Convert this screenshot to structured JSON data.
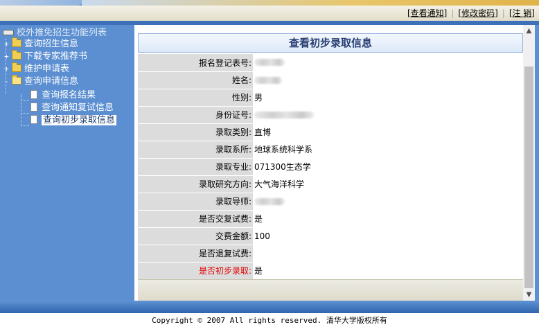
{
  "topnav": {
    "links": [
      "[查看通知]",
      "[修改密码]",
      "[注 销]"
    ],
    "separator": "|"
  },
  "sidebar": {
    "root_label": "校外推免招生功能列表",
    "items": [
      {
        "label": "查询招生信息",
        "icon": "folder-icon",
        "toggle": "+"
      },
      {
        "label": "下载专家推荐书",
        "icon": "folder-icon",
        "toggle": "+"
      },
      {
        "label": "维护申请表",
        "icon": "folder-icon",
        "toggle": "+"
      },
      {
        "label": "查询申请信息",
        "icon": "folder-open-icon",
        "toggle": "-",
        "children": [
          {
            "label": "查询报名结果",
            "icon": "document-icon"
          },
          {
            "label": "查询通知复试信息",
            "icon": "document-icon"
          },
          {
            "label": "查询初步录取信息",
            "icon": "document-icon",
            "selected": true
          }
        ]
      }
    ]
  },
  "main": {
    "title": "查看初步录取信息",
    "rows": [
      {
        "label": "报名登记表号:",
        "value": "",
        "redacted": true
      },
      {
        "label": "姓名:",
        "value": "",
        "redacted": true
      },
      {
        "label": "性别:",
        "value": "男"
      },
      {
        "label": "身份证号:",
        "value": "",
        "redacted": true
      },
      {
        "label": "录取类别:",
        "value": "直博"
      },
      {
        "label": "录取系所:",
        "value": "地球系统科学系"
      },
      {
        "label": "录取专业:",
        "value": "071300生态学"
      },
      {
        "label": "录取研究方向:",
        "value": "大气海洋科学"
      },
      {
        "label": "录取导师:",
        "value": "",
        "redacted": true
      },
      {
        "label": "是否交复试费:",
        "value": "是"
      },
      {
        "label": "交费金额:",
        "value": "100"
      },
      {
        "label": "是否退复试费:",
        "value": ""
      },
      {
        "label": "是否初步录取:",
        "value": "是",
        "highlight": true
      }
    ]
  },
  "footer": {
    "copyright": "Copyright © 2007 All rights reserved. 清华大学版权所有"
  },
  "colors": {
    "sidebar_bg": "#5b8fd1",
    "title_text": "#2a3f73",
    "highlight_label": "#e00000",
    "label_bg": "#dcdcdc"
  }
}
